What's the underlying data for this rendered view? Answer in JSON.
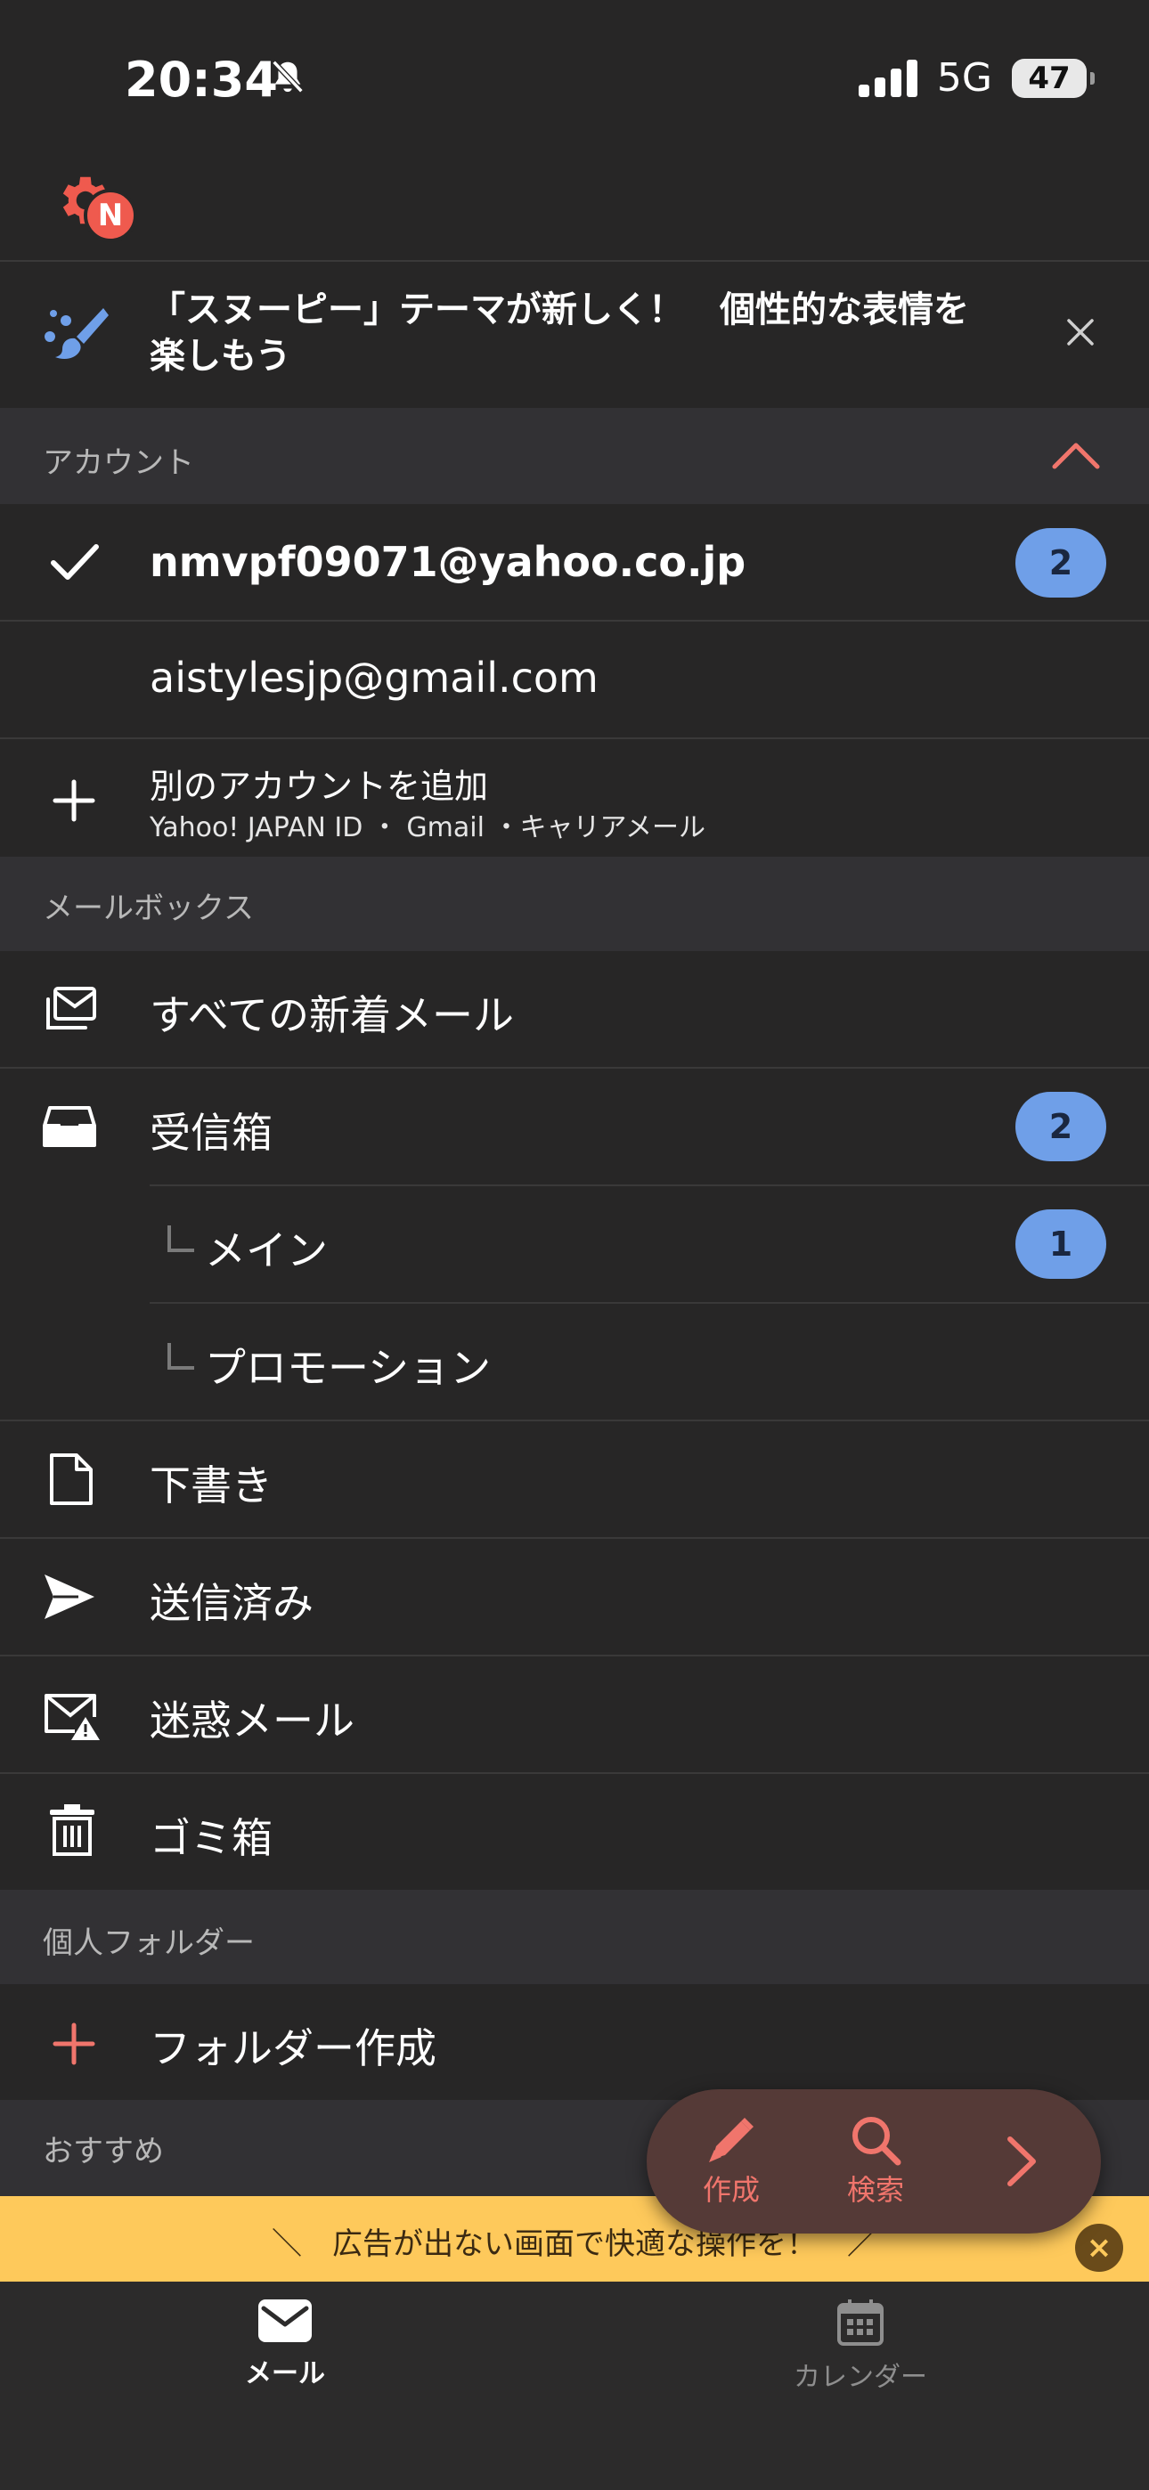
{
  "status_bar": {
    "time": "20:34",
    "network": "5G",
    "battery": "47"
  },
  "header": {
    "settings_badge": "N"
  },
  "banner": {
    "text_line1": "「スヌーピー」テーマが新しく！　個性的な表情を",
    "text_line2": "楽しもう"
  },
  "accounts": {
    "section_label": "アカウント",
    "items": [
      {
        "email": "nmvpf09071@yahoo.co.jp",
        "badge": "2",
        "selected": true
      },
      {
        "email": "aistylesjp@gmail.com"
      }
    ],
    "add_account": {
      "title": "別のアカウントを追加",
      "subtitle": "Yahoo! JAPAN ID ・ Gmail ・キャリアメール"
    }
  },
  "mailboxes": {
    "section_label": "メールボックス",
    "all_new": "すべての新着メール",
    "inbox": {
      "label": "受信箱",
      "badge": "2"
    },
    "main": {
      "label": "メイン",
      "badge": "1"
    },
    "promotion": {
      "label": "プロモーション"
    },
    "drafts": "下書き",
    "sent": "送信済み",
    "spam": "迷惑メール",
    "trash": "ゴミ箱"
  },
  "personal_folders": {
    "section_label": "個人フォルダー",
    "create": "フォルダー作成"
  },
  "recommended": {
    "section_label": "おすすめ"
  },
  "fab": {
    "compose": "作成",
    "search": "検索"
  },
  "ad": {
    "text": "＼　広告が出ない画面で快適な操作を！　／",
    "close": "×"
  },
  "tabbar": {
    "mail": "メール",
    "calendar": "カレンダー"
  },
  "colors": {
    "background": "#272626",
    "section": "#323134",
    "accent": "#f0756c",
    "badge": "#6f9fe8",
    "ad": "#fec95b"
  }
}
